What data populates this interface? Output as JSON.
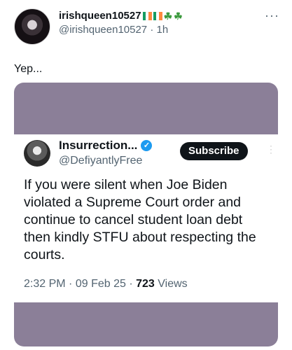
{
  "tweet": {
    "display_name": "irishqueen10527",
    "handle_time": "@irishqueen10527 · 1h",
    "text": "Yep...",
    "flag_colors": [
      "#169b62",
      "#ffffff",
      "#ff883e"
    ],
    "clover_icons": [
      "shamrock-icon",
      "shamrock-icon"
    ],
    "more_label": "···"
  },
  "quote": {
    "display_name": "Insurrection...",
    "handle": "@DefiyantlyFree",
    "verified_icon": "verified-badge-icon",
    "subscribe_label": "Subscribe",
    "text": "If you were silent when Joe Biden violated a Supreme Court order and continue to cancel student loan debt then kindly STFU about respecting the courts.",
    "time": "2:32 PM",
    "date": "09 Feb 25",
    "views_count": "723",
    "views_label": "Views"
  },
  "colors": {
    "embed_background": "#8b7f98",
    "verified_blue": "#1d9bf0"
  }
}
